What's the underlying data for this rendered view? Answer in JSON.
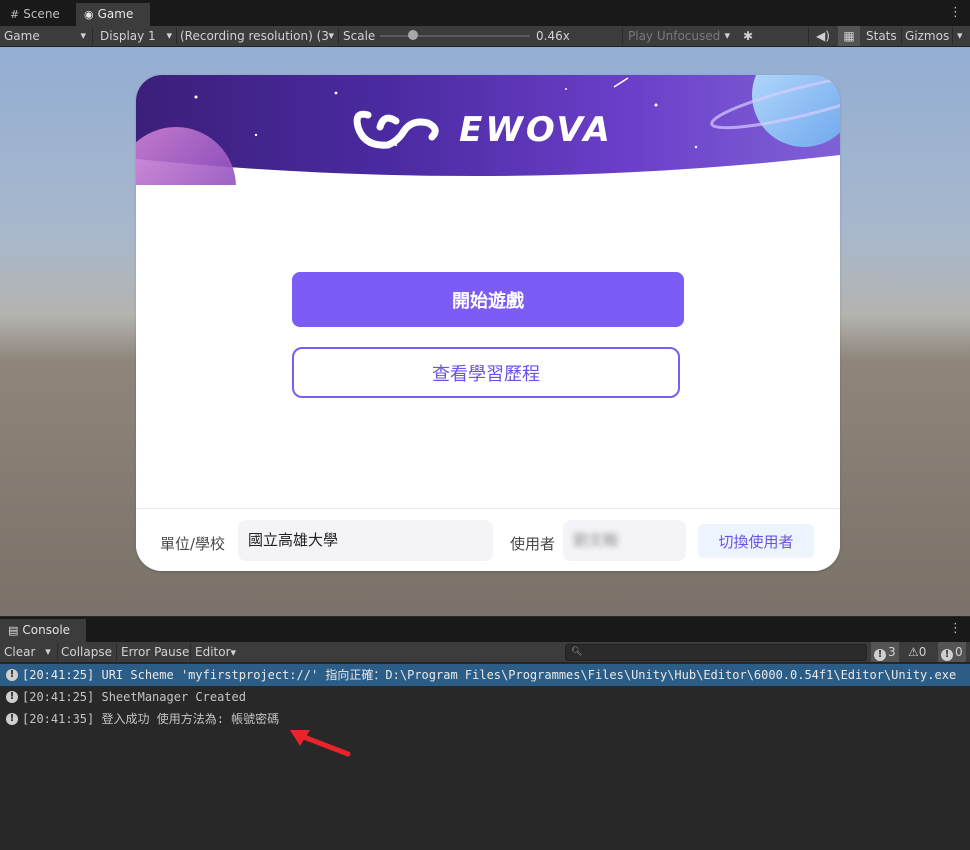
{
  "editor": {
    "tabs": [
      {
        "label": "Scene",
        "icon": "grid-icon"
      },
      {
        "label": "Game",
        "icon": "gamepad-icon"
      }
    ],
    "toolbar": {
      "view_mode": "Game",
      "display": "Display 1",
      "resolution": "(Recording resolution) (3",
      "scale_label": "Scale",
      "scale_value": "0.46x",
      "play_mode": "Play Unfocused",
      "stats": "Stats",
      "gizmos": "Gizmos"
    }
  },
  "game": {
    "logo_text": "EWOVA",
    "start_button": "開始遊戲",
    "history_button": "查看學習歷程",
    "unit_label": "單位/學校",
    "unit_value": "國立高雄大學",
    "user_label": "使用者",
    "user_value": "劉文翰",
    "switch_user_button": "切換使用者"
  },
  "console": {
    "tab_label": "Console",
    "clear": "Clear",
    "collapse": "Collapse",
    "error_pause": "Error Pause",
    "editor": "Editor",
    "counts": {
      "info": "3",
      "warning": "0",
      "error": "0"
    },
    "logs": [
      {
        "text": "[20:41:25] URI Scheme 'myfirstproject://' 指向正確：D:\\Program Files\\Programmes\\Files\\Unity\\Hub\\Editor\\6000.0.54f1\\Editor\\Unity.exe",
        "selected": true
      },
      {
        "text": "[20:41:25] SheetManager Created",
        "selected": false
      },
      {
        "text": "[20:41:35] 登入成功 使用方法為: 帳號密碼",
        "selected": false
      }
    ]
  },
  "colors": {
    "accent": "#7b5cf5",
    "selected_log": "#2c5d87",
    "annotation_arrow": "#e8242a"
  }
}
